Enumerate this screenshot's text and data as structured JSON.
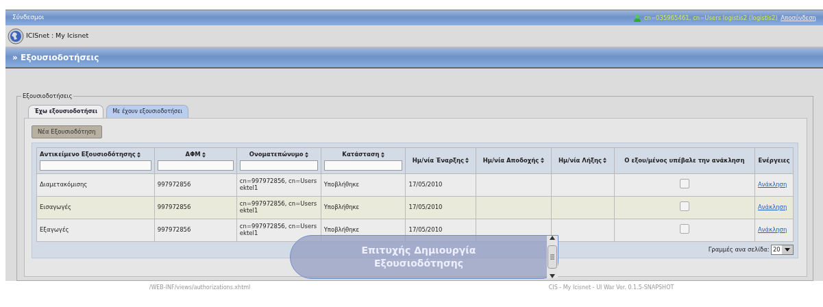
{
  "top_bar": {
    "title": "Σύνδεσμοι",
    "user": "cn=035965461, cn=Users logistis2 (logistis2)",
    "logout": "Αποσύνδεση"
  },
  "app_bar": {
    "title": "ICISnet : My Icisnet"
  },
  "section_bar": {
    "title": "» Εξουσιοδοτήσεις"
  },
  "fieldset": {
    "legend": "Εξουσιοδοτήσεις",
    "tabs": [
      {
        "label": "Έχω εξουσιοδοτήσει",
        "selected": true
      },
      {
        "label": "Με έχουν εξουσιοδοτήσει",
        "selected": false
      }
    ],
    "new_button": "Νέα Εξουσιοδότηση",
    "table": {
      "columns": [
        {
          "label": "Αντικείμενο Εξουσιοδότησης",
          "sortable": true,
          "filter": true
        },
        {
          "label": "ΑΦΜ",
          "sortable": true,
          "filter": true
        },
        {
          "label": "Ονοματεπώνυμο",
          "sortable": true,
          "filter": true
        },
        {
          "label": "Κατάσταση",
          "sortable": true,
          "filter": true
        },
        {
          "label": "Ημ/νία Έναρξης",
          "sortable": true,
          "filter": false
        },
        {
          "label": "Ημ/νία Αποδοχής",
          "sortable": true,
          "filter": false
        },
        {
          "label": "Ημ/νία Λήξης",
          "sortable": true,
          "filter": false
        },
        {
          "label": "Ο εξου/μένος υπέβαλε την ανάκληση",
          "sortable": false,
          "filter": false
        },
        {
          "label": "Ενέργειες",
          "sortable": false,
          "filter": false
        }
      ],
      "rows": [
        {
          "subject": "Διαμετακόμισης",
          "afm": "997972856",
          "name": "cn=997972856, cn=Users ektel1",
          "status": "Υποβλήθηκε",
          "start": "17/05/2010",
          "revoked": false,
          "action": "Ανάκληση"
        },
        {
          "subject": "Εισαγωγές",
          "afm": "997972856",
          "name": "cn=997972856, cn=Users ektel1",
          "status": "Υποβλήθηκε",
          "start": "17/05/2010",
          "revoked": false,
          "action": "Ανάκληση"
        },
        {
          "subject": "Εξαγωγές",
          "afm": "997972856",
          "name": "cn=997972856, cn=Users ektel1",
          "status": "Υποβλήθηκε",
          "start": "17/05/2010",
          "revoked": false,
          "action": "Ανάκληση"
        }
      ],
      "rows_per_page": {
        "label": "Γραμμές ανα σελίδα:",
        "value": "20"
      }
    }
  },
  "toast": {
    "message": "Επιτυχής Δημιουργία Εξουσιοδότησης"
  },
  "footer": {
    "left": "/WEB-INF/views/authorizations.xhtml",
    "right": "CIS - My Icisnet - UI War Ver. 0.1.5-SNAPSHOT"
  }
}
